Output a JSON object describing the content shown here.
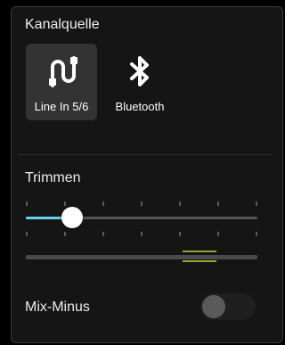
{
  "channel_source": {
    "title": "Kanalquelle",
    "options": [
      {
        "label": "Line In 5/6",
        "icon": "line-in-icon",
        "selected": true
      },
      {
        "label": "Bluetooth",
        "icon": "bluetooth-icon",
        "selected": false
      }
    ]
  },
  "trim": {
    "title": "Trimmen",
    "value_fraction": 0.2,
    "tick_count": 7
  },
  "meter": {
    "marker_fraction": 0.75
  },
  "mix_minus": {
    "label": "Mix-Minus",
    "enabled": false
  },
  "colors": {
    "accent": "#6bd0f2",
    "meter_marker": "#8fa935",
    "panel_bg": "#151515",
    "selected_bg": "#333333"
  }
}
